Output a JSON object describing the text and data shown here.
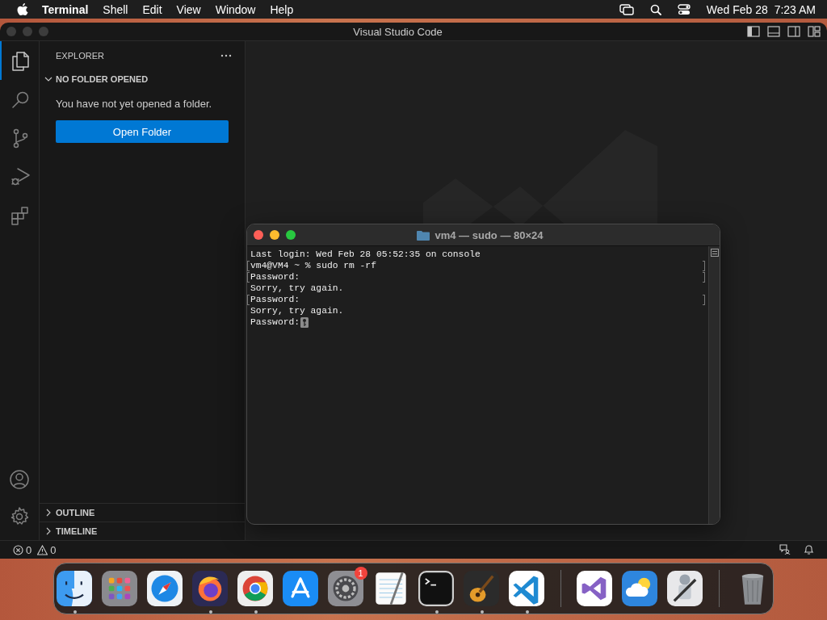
{
  "menu_bar": {
    "app": "Terminal",
    "items": [
      "Shell",
      "Edit",
      "View",
      "Window",
      "Help"
    ],
    "clock": "Wed Feb 28  7:23 AM"
  },
  "window": {
    "title": "Visual Studio Code"
  },
  "activity_bar": [
    {
      "kind": "files",
      "selected": true
    },
    {
      "kind": "search",
      "selected": false
    },
    {
      "kind": "scm",
      "selected": false
    },
    {
      "kind": "debug",
      "selected": false
    },
    {
      "kind": "extensions",
      "selected": false
    }
  ],
  "activity_bar_bottom": [
    {
      "kind": "account"
    },
    {
      "kind": "settings"
    }
  ],
  "sidebar": {
    "title": "EXPLORER",
    "section": {
      "label": "NO FOLDER OPENED",
      "expanded": true
    },
    "message": "You have not yet opened a folder.",
    "button": "Open Folder",
    "collapsed_sections": [
      {
        "label": "OUTLINE",
        "expanded": false
      },
      {
        "label": "TIMELINE",
        "expanded": false
      }
    ]
  },
  "terminal": {
    "title": "vm4 — sudo — 80×24",
    "lines": [
      {
        "text": "Last login: Wed Feb 28 05:52:35 on console",
        "marked": false
      },
      {
        "text": "vm4@VM4 ~ % sudo rm -rf",
        "marked": true
      },
      {
        "text": "Password:",
        "marked": true
      },
      {
        "text": "Sorry, try again.",
        "marked": false
      },
      {
        "text": "Password:",
        "marked": true
      },
      {
        "text": "Sorry, try again.",
        "marked": false
      },
      {
        "text": "Password:",
        "marked": false
      }
    ],
    "cursor": true
  },
  "status_bar": {
    "errors": "0",
    "warnings": "0"
  },
  "dock": [
    {
      "kind": "finder",
      "running": true
    },
    {
      "kind": "launchpad",
      "running": false
    },
    {
      "kind": "safari",
      "running": false
    },
    {
      "kind": "firefox",
      "running": true
    },
    {
      "kind": "chrome",
      "running": true
    },
    {
      "kind": "appstore",
      "running": false
    },
    {
      "kind": "settings",
      "running": false,
      "badge": "1"
    },
    {
      "kind": "textedit",
      "running": false
    },
    {
      "kind": "terminal",
      "running": true
    },
    {
      "kind": "garageband",
      "running": true
    },
    {
      "kind": "vscode",
      "running": true
    },
    {
      "kind": "separator"
    },
    {
      "kind": "visualstudio",
      "running": false
    },
    {
      "kind": "weather",
      "running": false
    },
    {
      "kind": "automator",
      "running": false
    },
    {
      "kind": "separator"
    },
    {
      "kind": "trash",
      "running": false
    }
  ]
}
